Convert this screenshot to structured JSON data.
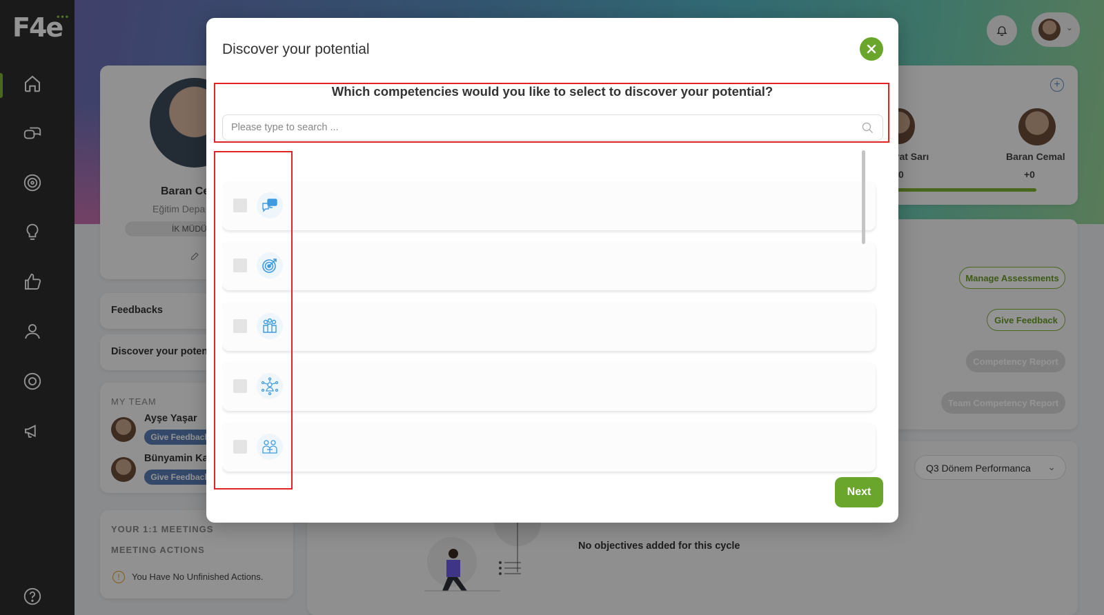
{
  "app": {
    "logo_text": "F4e",
    "logo_dots": "•••"
  },
  "sidebar": {
    "items": [
      {
        "name": "home-icon"
      },
      {
        "name": "chat-icon"
      },
      {
        "name": "target-icon"
      },
      {
        "name": "lightbulb-icon"
      },
      {
        "name": "thumbs-up-icon"
      },
      {
        "name": "people-icon"
      },
      {
        "name": "settings-icon"
      },
      {
        "name": "megaphone-icon"
      },
      {
        "name": "help-icon"
      }
    ]
  },
  "profile": {
    "name": "Baran Ce",
    "department": "Eğitim Depa",
    "role": "İK MÜDÜ"
  },
  "left_menu": {
    "feedbacks": "Feedbacks",
    "discover": "Discover your poten"
  },
  "my_team": {
    "title": "MY TEAM",
    "members": [
      {
        "name": "Ayşe Yaşar",
        "button": "Give Feedbacl"
      },
      {
        "name": "Bünyamin Ka",
        "button": "Give Feedbacl"
      }
    ]
  },
  "meetings": {
    "title": "YOUR 1:1 MEETINGS",
    "actions_title": "MEETING ACTIONS",
    "no_actions": "You Have No Unfinished Actions."
  },
  "people": [
    {
      "name": "rat Sarı",
      "score": "0"
    },
    {
      "name": "Baran Cemal",
      "score": "+0"
    }
  ],
  "right_buttons": {
    "manage": "Manage Assessments",
    "give_feedback": "Give Feedback",
    "competency_report": "Competency Report",
    "team_report": "Team Competency Report"
  },
  "cycle_select": {
    "value": "Q3 Dönem Performanca"
  },
  "objectives": {
    "empty": "No objectives added for this cycle"
  },
  "modal": {
    "title": "Discover your potential",
    "question": "Which competencies would you like to select to discover your potential?",
    "search_placeholder": "Please type to search ...",
    "next_label": "Next",
    "items": [
      {
        "icon": "communication-icon"
      },
      {
        "icon": "target-icon"
      },
      {
        "icon": "team-icon"
      },
      {
        "icon": "network-icon"
      },
      {
        "icon": "collaboration-icon"
      }
    ]
  },
  "colors": {
    "accent": "#6aa62c",
    "highlight": "#e32222",
    "sidebar": "#2d2d2d",
    "icon_blue": "#3d9be0"
  }
}
